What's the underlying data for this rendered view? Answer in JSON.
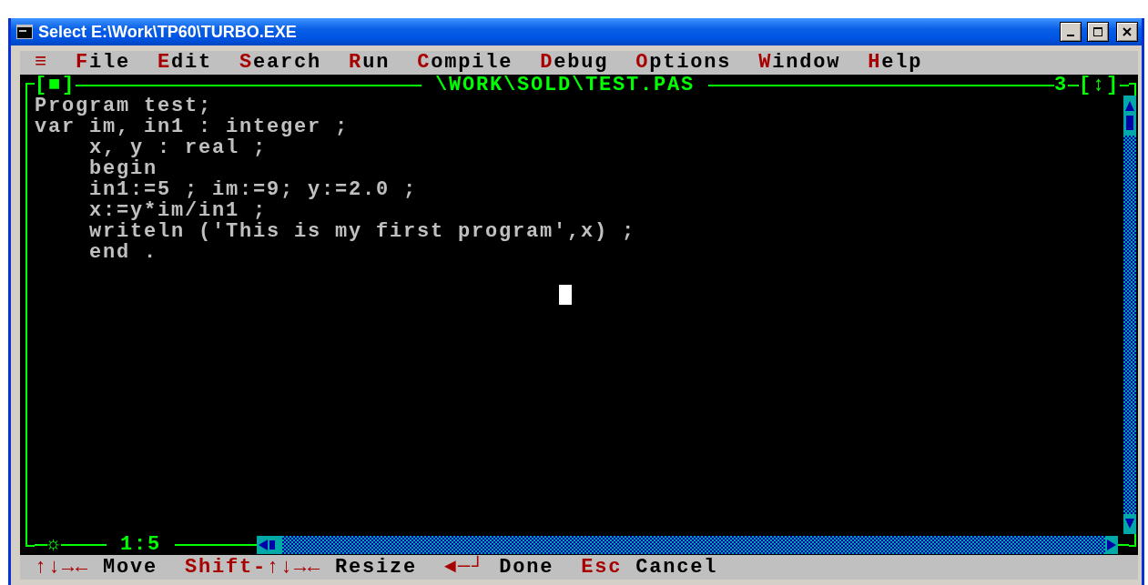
{
  "window": {
    "title": "Select E:\\Work\\TP60\\TURBO.EXE"
  },
  "menu": [
    {
      "label": "≡"
    },
    {
      "label": "File"
    },
    {
      "label": "Edit"
    },
    {
      "label": "Search"
    },
    {
      "label": "Run"
    },
    {
      "label": "Compile"
    },
    {
      "label": "Debug"
    },
    {
      "label": "Options"
    },
    {
      "label": "Window"
    },
    {
      "label": "Help"
    }
  ],
  "editor": {
    "close_box": "[■]",
    "file_name": "\\WORK\\SOLD\\TEST.PAS",
    "window_number": "3",
    "zoom_box": "[↕]",
    "lines": [
      "Program test;",
      "var im, in1 : integer ;",
      "    x, y : real ;",
      "    begin",
      "    in1:=5 ; im:=9; y:=2.0 ;",
      "    x:=y*im/in1 ;",
      "    writeln ('This is my first program',x) ;",
      "    end ."
    ],
    "modified_mark": "☼",
    "cursor_position": "1:5"
  },
  "status_bar": [
    {
      "key": "↑↓→←",
      "label": "Move"
    },
    {
      "key": "Shift-↑↓→←",
      "label": "Resize"
    },
    {
      "key": "◄─┘",
      "label": "Done"
    },
    {
      "key": "Esc",
      "label": "Cancel"
    }
  ]
}
